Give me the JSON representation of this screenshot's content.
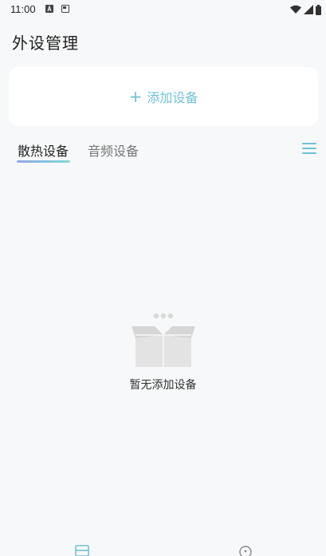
{
  "status_bar": {
    "time": "11:00",
    "left_icons": [
      "a-notification-icon",
      "media-notification-icon"
    ],
    "right_icons": [
      "wifi-icon",
      "signal-icon",
      "battery-icon"
    ]
  },
  "header": {
    "title": "外设管理"
  },
  "add_device": {
    "icon": "plus-icon",
    "plus_glyph": "+",
    "label": "添加设备"
  },
  "tabs": [
    {
      "label": "散热设备",
      "active": true
    },
    {
      "label": "音频设备",
      "active": false
    }
  ],
  "tab_menu_icon": "menu-icon",
  "empty_state": {
    "icon": "empty-box-icon",
    "text": "暂无添加设备"
  },
  "bottom_nav": {
    "items": [
      {
        "icon": "devices-tab-icon"
      },
      {
        "icon": "profile-tab-icon"
      }
    ]
  },
  "colors": {
    "accent": "#6fc2d4",
    "background": "#f7f8f9",
    "card": "#ffffff",
    "tab_underline_start": "#8fa8e8",
    "tab_underline_end": "#7fd9d6"
  }
}
